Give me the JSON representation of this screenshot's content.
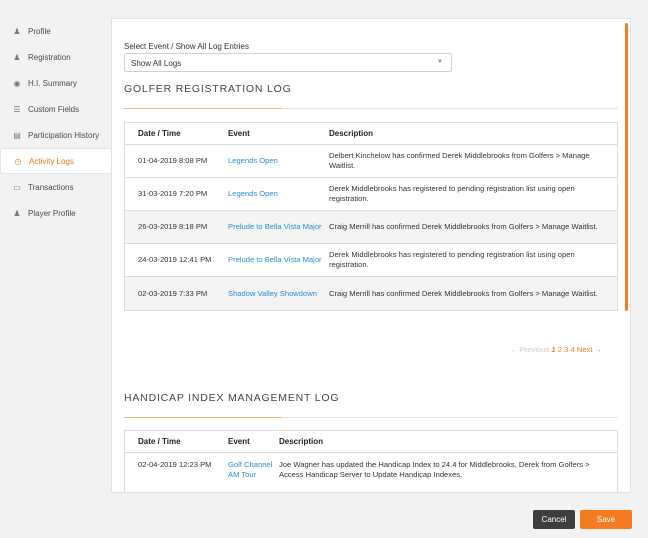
{
  "sidebar": {
    "items": [
      {
        "label": "Profile",
        "icon": "person-icon",
        "glyph": "♟"
      },
      {
        "label": "Registration",
        "icon": "person-add-icon",
        "glyph": "♟"
      },
      {
        "label": "H.I. Summary",
        "icon": "map-pin-icon",
        "glyph": "◉"
      },
      {
        "label": "Custom Fields",
        "icon": "list-icon",
        "glyph": "☰"
      },
      {
        "label": "Participation History",
        "icon": "calendar-icon",
        "glyph": "▤"
      },
      {
        "label": "Activity Logs",
        "icon": "clock-icon",
        "glyph": "◷"
      },
      {
        "label": "Transactions",
        "icon": "credit-card-icon",
        "glyph": "▭"
      },
      {
        "label": "Player Profile",
        "icon": "golfer-icon",
        "glyph": "♟"
      }
    ],
    "active_index": 5
  },
  "filter": {
    "label": "Select Event / Show All Log Entries",
    "value": "Show All Logs"
  },
  "golfer_log": {
    "title": "GOLFER REGISTRATION LOG",
    "headers": [
      "Date / Time",
      "Event",
      "Description"
    ],
    "rows": [
      {
        "date": "01-04-2019 8:08 PM",
        "event": "Legends Open",
        "desc": "Delbert Kinchelow has confirmed Derek Middlebrooks from Golfers > Manage Waitlist."
      },
      {
        "date": "31-03-2019 7:20 PM",
        "event": "Legends Open",
        "desc": "Derek Middlebrooks has registered to pending registration list using open registration."
      },
      {
        "date": "26-03-2019 8:18 PM",
        "event": "Prelude to Bella Vista Major",
        "desc": "Craig Merrill has confirmed Derek Middlebrooks from Golfers > Manage Waitlist."
      },
      {
        "date": "24-03-2019 12:41 PM",
        "event": "Prelude to Bella Vista Major",
        "desc": "Derek Middlebrooks has registered to pending registration list using open registration."
      },
      {
        "date": "02-03-2019 7:33 PM",
        "event": "Shadow Valley Showdown",
        "desc": "Craig Merrill has confirmed Derek Middlebrooks from Golfers > Manage Waitlist."
      }
    ]
  },
  "pagination": {
    "previous": "← Previous",
    "pages": [
      "1",
      "2",
      "3",
      "4"
    ],
    "current": "1",
    "next": "Next →"
  },
  "handicap_log": {
    "title": "HANDICAP INDEX MANAGEMENT LOG",
    "headers": [
      "Date / Time",
      "Event",
      "Description"
    ],
    "rows": [
      {
        "date": "02-04-2019 12:23 PM",
        "event": "Golf Channel AM Tour",
        "desc": "Joe Wagner has updated the Handicap Index to 24.4 for Middlebrooks, Derek from Golfers > Access Handicap Server to Update Handicap Indexes."
      }
    ]
  },
  "footer": {
    "cancel": "Cancel",
    "save": "Save"
  },
  "colors": {
    "accent": "#f47b20",
    "link": "#2a8ed0"
  }
}
